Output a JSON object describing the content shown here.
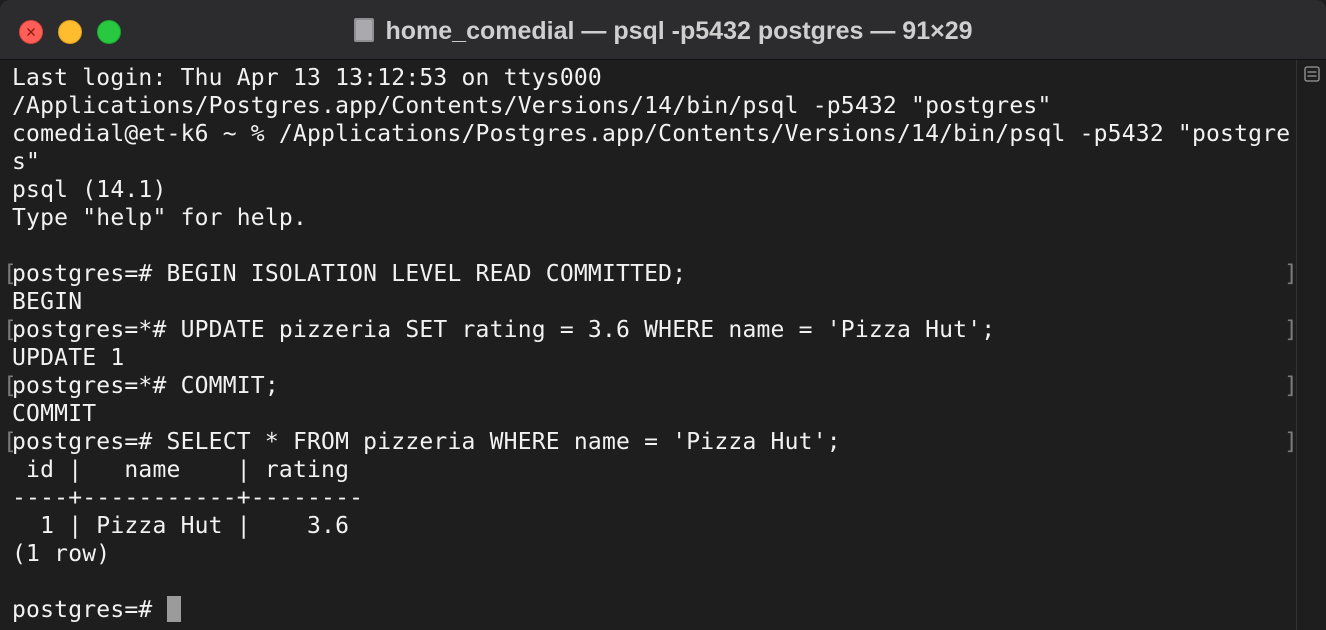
{
  "window": {
    "title": "home_comedial — psql -p5432 postgres — 91×29",
    "colors": {
      "close": "#ff5f57",
      "minimize": "#febc2e",
      "maximize": "#28c840",
      "background": "#1e1e1e",
      "text": "#f2f2f2"
    }
  },
  "terminal": {
    "lines": [
      "Last login: Thu Apr 13 13:12:53 on ttys000",
      "/Applications/Postgres.app/Contents/Versions/14/bin/psql -p5432 \"postgres\"",
      "comedial@et-k6 ~ % /Applications/Postgres.app/Contents/Versions/14/bin/psql -p5432 \"postgre",
      "s\"",
      "psql (14.1)",
      "Type \"help\" for help.",
      "",
      "postgres=# BEGIN ISOLATION LEVEL READ COMMITTED;",
      "BEGIN",
      "postgres=*# UPDATE pizzeria SET rating = 3.6 WHERE name = 'Pizza Hut';",
      "UPDATE 1",
      "postgres=*# COMMIT;",
      "COMMIT",
      "postgres=# SELECT * FROM pizzeria WHERE name = 'Pizza Hut';",
      " id |   name    | rating",
      "----+-----------+--------",
      "  1 | Pizza Hut |    3.6",
      "(1 row)",
      "",
      "postgres=# "
    ],
    "bracketed_lines": [
      7,
      9,
      11,
      13
    ],
    "bracket_left": "[",
    "bracket_right": "]"
  }
}
